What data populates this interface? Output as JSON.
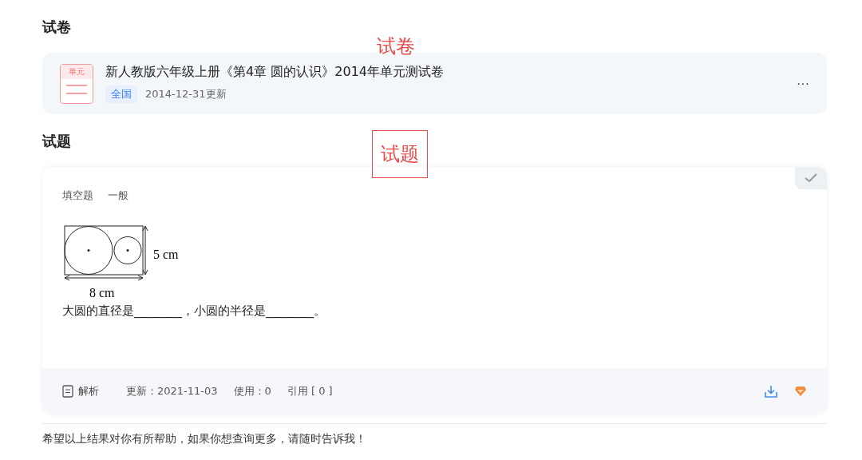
{
  "paper_section": {
    "heading": "试卷",
    "paper": {
      "badge": "单元",
      "title": "新人教版六年级上册《第4章 圆的认识》2014年单元测试卷",
      "tag": "全国",
      "updated": "2014-12-31更新",
      "more": "···"
    }
  },
  "question_section": {
    "heading": "试题",
    "question": {
      "checked": true,
      "type": "填空题",
      "difficulty": "一般",
      "figure": {
        "height_label": "5 cm",
        "width_label": "8 cm"
      },
      "text": "大圆的直径是________，小圆的半径是________。",
      "analysis": "解析",
      "updated": "更新：2021-11-03",
      "used": "使用：0",
      "cited": "引用 [ 0 ]"
    }
  },
  "annotations": [
    {
      "kind": "plain",
      "text": "试卷"
    },
    {
      "kind": "boxed",
      "text": "试题"
    }
  ],
  "closing": "希望以上结果对你有所帮助，如果你想查询更多，请随时告诉我！"
}
